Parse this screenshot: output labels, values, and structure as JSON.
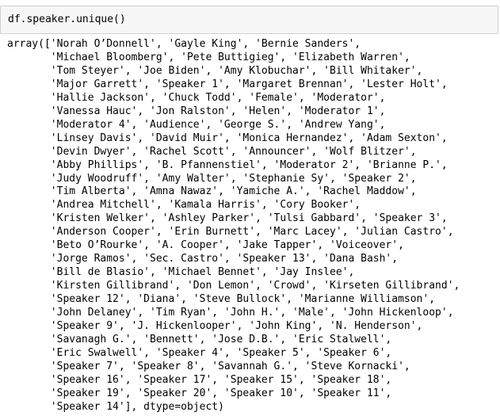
{
  "cell": {
    "code": "df.speaker.unique()"
  },
  "output": {
    "lines": [
      "array(['Norah O’Donnell', 'Gayle King', 'Bernie Sanders',",
      "       'Michael Bloomberg', 'Pete Buttigieg', 'Elizabeth Warren',",
      "       'Tom Steyer', 'Joe Biden', 'Amy Klobuchar', 'Bill Whitaker',",
      "       'Major Garrett', 'Speaker 1', 'Margaret Brennan', 'Lester Holt',",
      "       'Hallie Jackson', 'Chuck Todd', 'Female', 'Moderator',",
      "       'Vanessa Hauc', 'Jon Ralston', 'Helen', 'Moderator 1',",
      "       'Moderator 4', 'Audience', 'George S.', 'Andrew Yang',",
      "       'Linsey Davis', 'David Muir', 'Monica Hernandez', 'Adam Sexton',",
      "       'Devin Dwyer', 'Rachel Scott', 'Announcer', 'Wolf Blitzer',",
      "       'Abby Phillips', 'B. Pfannenstiel', 'Moderator 2', 'Brianne P.',",
      "       'Judy Woodruff', 'Amy Walter', 'Stephanie Sy', 'Speaker 2',",
      "       'Tim Alberta', 'Amna Nawaz', 'Yamiche A.', 'Rachel Maddow',",
      "       'Andrea Mitchell', 'Kamala Harris', 'Cory Booker',",
      "       'Kristen Welker', 'Ashley Parker', 'Tulsi Gabbard', 'Speaker 3',",
      "       'Anderson Cooper', 'Erin Burnett', 'Marc Lacey', 'Julian Castro',",
      "       'Beto O’Rourke', 'A. Cooper', 'Jake Tapper', 'Voiceover',",
      "       'Jorge Ramos', 'Sec. Castro', 'Speaker 13', 'Dana Bash',",
      "       'Bill de Blasio', 'Michael Bennet', 'Jay Inslee',",
      "       'Kirsten Gillibrand', 'Don Lemon', 'Crowd', 'Kirseten Gillibrand',",
      "       'Speaker 12', 'Diana', 'Steve Bullock', 'Marianne Williamson',",
      "       'John Delaney', 'Tim Ryan', 'John H.', 'Male', 'John Hickenloop',",
      "       'Speaker 9', 'J. Hickenlooper', 'John King', 'N. Henderson',",
      "       'Savanagh G.', 'Bennett', 'Jose D.B.', 'Eric Stalwell',",
      "       'Eric Swalwell', 'Speaker 4', 'Speaker 5', 'Speaker 6',",
      "       'Speaker 7', 'Speaker 8', 'Savannah G.', 'Steve Kornacki',",
      "       'Speaker 16', 'Speaker 17', 'Speaker 15', 'Speaker 18',",
      "       'Speaker 19', 'Speaker 20', 'Speaker 10', 'Speaker 11',",
      "       'Speaker 14'], dtype=object)"
    ]
  }
}
